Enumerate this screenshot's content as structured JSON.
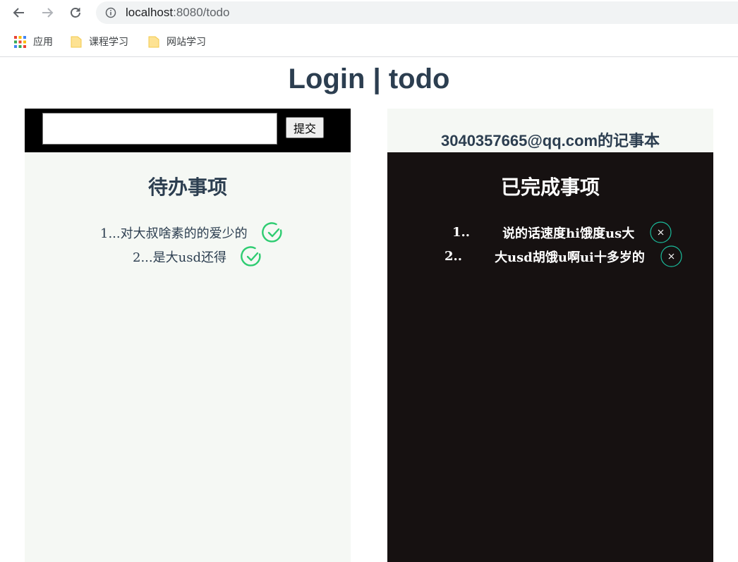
{
  "browser": {
    "url_host": "localhost",
    "url_rest": ":8080/todo",
    "bookmarks": [
      "应用",
      "课程学习",
      "网站学习"
    ]
  },
  "page": {
    "title": "Login | todo"
  },
  "todo": {
    "input_value": "",
    "submit_label": "提交",
    "section_title": "待办事项",
    "items": [
      "1...对大叔啥素的的爱少的",
      "2...是大usd还得"
    ]
  },
  "done": {
    "notebook_title": "3040357665@qq.com的记事本",
    "section_title": "已完成事项",
    "items": [
      {
        "num": "1..",
        "text": "说的话速度hi饿度us大"
      },
      {
        "num": "2..",
        "text": "大usd胡饿u啊ui十多岁的"
      }
    ]
  },
  "colors": {
    "title": "#2c3e50",
    "check": "#2ecc71",
    "close": "#1abc9c",
    "left_bg": "#f5f8f4",
    "right_bg": "#161111"
  }
}
